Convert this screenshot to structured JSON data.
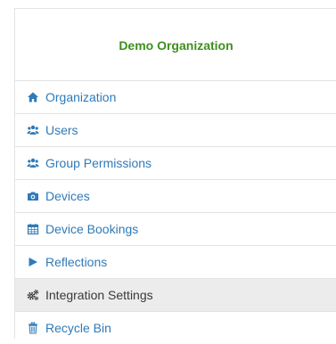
{
  "organization": {
    "name": "Demo Organization"
  },
  "menu": {
    "items": [
      {
        "label": "Organization",
        "icon": "home-icon"
      },
      {
        "label": "Users",
        "icon": "users-icon"
      },
      {
        "label": "Group Permissions",
        "icon": "users-icon"
      },
      {
        "label": "Devices",
        "icon": "camera-icon"
      },
      {
        "label": "Device Bookings",
        "icon": "calendar-icon"
      },
      {
        "label": "Reflections",
        "icon": "play-icon"
      },
      {
        "label": "Integration Settings",
        "icon": "gears-icon",
        "active": true
      },
      {
        "label": "Recycle Bin",
        "icon": "trash-icon"
      }
    ]
  },
  "colors": {
    "link": "#2f7ab8",
    "org_name": "#3f8f1f",
    "active_bg": "#ececec",
    "border": "#e3e3e3"
  }
}
